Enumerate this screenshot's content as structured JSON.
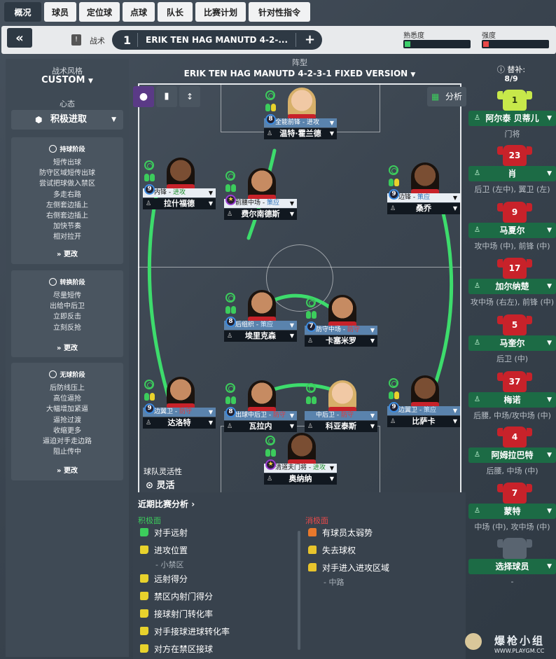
{
  "tabs": [
    "概况",
    "球员",
    "定位球",
    "点球",
    "队长",
    "比赛计划",
    "针对性指令"
  ],
  "topbar": {
    "back": "«",
    "tactic_label": "战术",
    "slot": "1",
    "tactic_name": "ERIK TEN HAG MANUTD 4-2-...",
    "add": "+",
    "familiarity": "熟悉度",
    "intensity": "强度",
    "colors": {
      "familiarity": "#3dcf6b",
      "intensity": "#e84848"
    }
  },
  "left": {
    "style_label": "战术风格",
    "style_value": "CUSTOM",
    "mentality_label": "心态",
    "mentality_value": "积极进取",
    "in_possession": {
      "title": "持球阶段",
      "lines": [
        "短传出球",
        "防守区域短传出球",
        "尝试把球做入禁区",
        "多走右路",
        "左侧套边插上",
        "右侧套边插上",
        "加快节奏",
        "相对拉开"
      ],
      "more": "更改"
    },
    "transition": {
      "title": "转换阶段",
      "lines": [
        "尽量短传",
        "出给中后卫",
        "立即反击",
        "立刻反抢"
      ],
      "more": "更改"
    },
    "out_possession": {
      "title": "无球阶段",
      "lines": [
        "后防线压上",
        "高位逼抢",
        "大幅增加紧逼",
        "逼抢过渡",
        "收缩更多",
        "逼迫对手走边路",
        "阻止传中"
      ],
      "more": "更改"
    }
  },
  "center": {
    "formation_label": "阵型",
    "formation_name": "ERIK TEN HAG MANUTD 4-2-3-1 FIXED VERSION",
    "analysis": "分析",
    "fluidity_label": "球队灵活性",
    "fluidity_value": "灵活"
  },
  "players": [
    {
      "pos": "st",
      "role": "全能前锋",
      "duty": "进攻",
      "duty_type": "att",
      "name": "温特·霍兰德",
      "num": "8",
      "star": false,
      "face": "light",
      "blue": true
    },
    {
      "pos": "lw",
      "role": "内锋",
      "duty": "进攻",
      "duty_type": "att",
      "name": "拉什福德",
      "num": "9",
      "star": false,
      "face": "dark",
      "blue": false
    },
    {
      "pos": "am",
      "role": "前腰中场",
      "duty": "策应",
      "duty_type": "sup",
      "name": "费尔南德斯",
      "num": "",
      "star": true,
      "face": "mid",
      "blue": false
    },
    {
      "pos": "rw",
      "role": "边锋",
      "duty": "策应",
      "duty_type": "sup",
      "name": "桑乔",
      "num": "9",
      "star": false,
      "face": "dark",
      "blue": false
    },
    {
      "pos": "dm1",
      "role": "后组织",
      "duty": "策应",
      "duty_type": "sup",
      "name": "埃里克森",
      "num": "8",
      "star": false,
      "face": "mid",
      "blue": true
    },
    {
      "pos": "dm2",
      "role": "防守中场",
      "duty": "防守",
      "duty_type": "def",
      "name": "卡塞米罗",
      "num": "7",
      "star": false,
      "face": "mid",
      "blue": true
    },
    {
      "pos": "lb",
      "role": "边翼卫",
      "duty": "防守",
      "duty_type": "def",
      "name": "达洛特",
      "num": "9",
      "star": false,
      "face": "mid",
      "blue": true
    },
    {
      "pos": "cb1",
      "role": "出球中后卫",
      "duty": "防守",
      "duty_type": "def",
      "name": "瓦拉内",
      "num": "8",
      "star": false,
      "face": "mid",
      "blue": true
    },
    {
      "pos": "cb2",
      "role": "中后卫",
      "duty": "防守",
      "duty_type": "def",
      "name": "科亚泰斯",
      "num": "",
      "star": false,
      "face": "light",
      "blue": true
    },
    {
      "pos": "rb",
      "role": "边翼卫",
      "duty": "策应",
      "duty_type": "sup",
      "name": "比萨卡",
      "num": "9",
      "star": false,
      "face": "dark",
      "blue": true
    },
    {
      "pos": "gk",
      "role": "清道夫门将",
      "duty": "进攻",
      "duty_type": "att",
      "name": "奥纳纳",
      "num": "",
      "star": true,
      "face": "dark",
      "blue": false
    }
  ],
  "subs": {
    "label": "替补:",
    "count": "8/9",
    "players": [
      {
        "shirt": "1",
        "name": "阿尔泰 贝蒂儿",
        "pos": "门将",
        "gk": true
      },
      {
        "shirt": "23",
        "name": "肖",
        "pos": "后卫 (左中), 翼卫 (左)"
      },
      {
        "shirt": "9",
        "name": "马夏尔",
        "pos": "攻中场 (中), 前锋 (中)"
      },
      {
        "shirt": "17",
        "name": "加尔纳楚",
        "pos": "攻中场 (右左), 前锋 (中)"
      },
      {
        "shirt": "5",
        "name": "马奎尔",
        "pos": "后卫 (中)"
      },
      {
        "shirt": "37",
        "name": "梅诺",
        "pos": "后腰, 中场/攻中场 (中)"
      },
      {
        "shirt": "4",
        "name": "阿姆拉巴特",
        "pos": "后腰, 中场 (中)"
      },
      {
        "shirt": "7",
        "name": "蒙特",
        "pos": "中场 (中), 攻中场 (中)"
      }
    ],
    "choose": "选择球员",
    "choose_sub": "-"
  },
  "analysis": {
    "title": "近期比赛分析",
    "positive_label": "积极面",
    "negative_label": "消极面",
    "positives": [
      {
        "text": "对手远射"
      },
      {
        "text": "进攻位置",
        "detail": "- 小禁区"
      },
      {
        "text": "远射得分"
      },
      {
        "text": "禁区内射门得分"
      },
      {
        "text": "接球射门转化率"
      },
      {
        "text": "对手接球进球转化率"
      },
      {
        "text": "对方在禁区接球"
      }
    ],
    "negatives": [
      {
        "text": "有球员太弱势"
      },
      {
        "text": "失去球权"
      },
      {
        "text": "对手进入进攻区域",
        "detail": "- 中路"
      }
    ]
  },
  "watermark": {
    "brand": "爆枪小组",
    "url": "WWW.PLAYGM.CC"
  }
}
